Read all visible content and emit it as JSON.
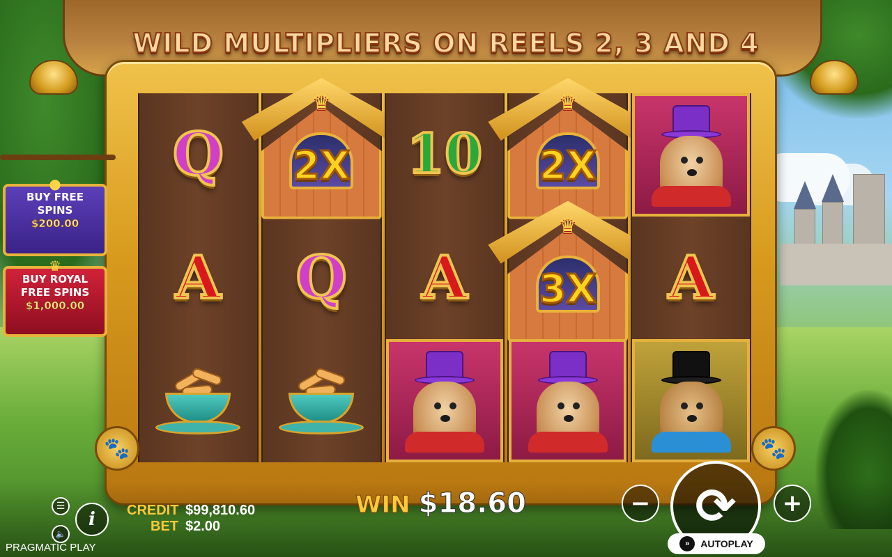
{
  "title": "WILD MULTIPLIERS ON REELS 2, 3 AND 4",
  "buy_free_spins": {
    "label": "BUY FREE SPINS",
    "price": "$200.00"
  },
  "buy_royal_free_spins": {
    "label": "BUY ROYAL FREE SPINS",
    "price": "$1,000.00"
  },
  "reels": [
    [
      "Q",
      "A",
      "bones-cup"
    ],
    [
      "kennel-wild",
      "Q",
      "bones-cup"
    ],
    [
      "10",
      "A",
      "yorkie-dog"
    ],
    [
      "kennel-wild",
      "kennel-wild",
      "yorkie-dog"
    ],
    [
      "yorkie-dog",
      "A",
      "pug-dog"
    ]
  ],
  "wild_multipliers": {
    "reel2_row1": "2X",
    "reel4_row1": "2X",
    "reel4_row2": "3X"
  },
  "win": {
    "label": "WIN",
    "value": "$18.60"
  },
  "credit": {
    "label": "CREDIT",
    "value": "$99,810.60"
  },
  "bet": {
    "label": "BET",
    "value": "$2.00"
  },
  "autoplay_label": "AUTOPLAY",
  "brand": "PRAGMATIC PLAY",
  "icons": {
    "menu": "hamburger-icon",
    "sound": "speaker-icon",
    "info": "info-icon",
    "minus": "minus-icon",
    "plus": "plus-icon",
    "spin": "spin-icon",
    "paw": "paw-icon"
  },
  "colors": {
    "gold": "#e9b23a",
    "win_label": "#ffc93a",
    "buy_purple": "#5b3fb8",
    "buy_red": "#d0223a"
  }
}
